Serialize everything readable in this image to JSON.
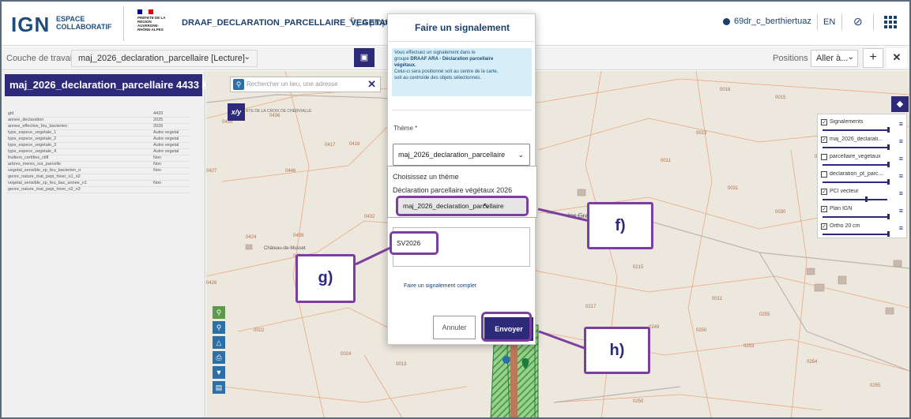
{
  "header": {
    "logo_ign": "IGN",
    "logo_ec_line1": "ESPACE",
    "logo_ec_line2": "COLLABORATIF",
    "marianne_text": "PRÉFETE DE LA RÉGION AUVERGNE-RHÔNE-ALPES",
    "app_title": "DRAAF_DECLARATION_PARCELLAIRE_VEGETAUX",
    "apropos": "A propo",
    "user": "69dr_c_berthiertuaz",
    "lang": "EN"
  },
  "toolbar": {
    "couche_label": "Couche de travail",
    "couche_value": "maj_2026_declaration_parcellaire [Lecture]",
    "positions_label": "Positions",
    "positions_value": "Aller à..."
  },
  "left_panel": {
    "title": "maj_2026_declaration_parcellaire 4433",
    "rows": [
      {
        "k": "gid",
        "v": "4433"
      },
      {
        "k": "annee_declaration",
        "v": "2025"
      },
      {
        "k": "annee_effective_feu_bacterien",
        "v": "2026"
      },
      {
        "k": "type_espece_vegetale_1",
        "v": "Autre vegetal"
      },
      {
        "k": "type_espece_vegetale_2",
        "v": "Autre vegetal"
      },
      {
        "k": "type_espece_vegetale_3",
        "v": "Autre vegetal"
      },
      {
        "k": "type_espece_vegetale_4",
        "v": "Autre vegetal"
      },
      {
        "k": "fruitiers_certifies_ctifl",
        "v": "Non"
      },
      {
        "k": "arbres_meres_sur_parcelle",
        "v": "Non"
      },
      {
        "k": "vegetal_sensible_zp_feu_bacterien_n",
        "v": "Non"
      },
      {
        "k": "genre_nature_mat_pepi_hiver_n1_n2",
        "v": ""
      },
      {
        "k": "vegetal_sensible_zp_feu_bac_annee_n1",
        "v": "Non"
      },
      {
        "k": "genre_nature_mat_pepi_hiver_n2_n3",
        "v": ""
      }
    ]
  },
  "map": {
    "search_placeholder": "Rechercher un lieu, une adresse",
    "xy": "x/y",
    "place_label": "Château-de-Musset",
    "village_label": "les Gra",
    "road_label": "RTE DE LA CROIX DE CHERVIALLE"
  },
  "layers": [
    {
      "name": "Signalements",
      "checked": true
    },
    {
      "name": "maj_2026_declarati...",
      "checked": true
    },
    {
      "name": "parcellaire_vegetaux",
      "checked": false
    },
    {
      "name": "declaration_pt_parc...",
      "checked": false
    },
    {
      "name": "PCI vecteur",
      "checked": true
    },
    {
      "name": "Plan IGN",
      "checked": true
    },
    {
      "name": "Ortho 20 cm",
      "checked": true
    }
  ],
  "modal": {
    "title": "Faire un signalement",
    "info_line1": "Vous effectuez un signalement dans le",
    "info_line2_pre": "groupe ",
    "info_line2_bold": "DRAAF ARA - Déclaration parcellaire",
    "info_line3_bold": "végétaux.",
    "info_line4": "Celui-ci sera positionné soit au centre de la carte,",
    "info_line5": "soit au centroïde des objets sélectionnés.",
    "theme_label": "Thème *",
    "theme_value": "maj_2026_declaration_parcellaire",
    "dropdown_options": [
      "Choisissez un thème",
      "Déclaration parcellaire végétaux 2026",
      "maj_2026_declaration_parcellaire"
    ],
    "text_value": "SV2026",
    "complet_link": "Faire un signalement complet",
    "cancel": "Annuler",
    "send": "Envoyer"
  },
  "callouts": {
    "f": "f)",
    "g": "g)",
    "h": "h)"
  },
  "colors": {
    "accent": "#2e2a7a",
    "callout": "#7b3fa0",
    "info_bg": "#d6eef7"
  }
}
